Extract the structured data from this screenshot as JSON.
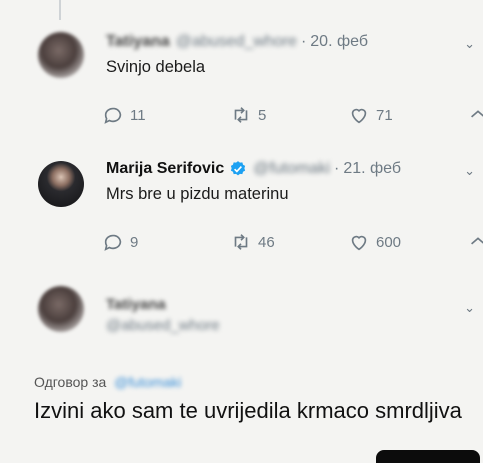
{
  "tweets": [
    {
      "name": "Tatiyana",
      "handle": "@abused_whore",
      "date": "20. феб",
      "text": "Svinjo debela",
      "replies": "11",
      "retweets": "5",
      "likes": "71"
    },
    {
      "name": "Marija Serifovic",
      "handle": "@futomaki",
      "date": "21. феб",
      "text": "Mrs bre u pizdu materinu",
      "replies": "9",
      "retweets": "46",
      "likes": "600"
    }
  ],
  "reply_tweet": {
    "name": "Tatiyana",
    "handle": "@abused_whore",
    "reply_prefix": "Одговор за",
    "reply_handle": "@futomaki",
    "text": "Izvini ako sam te uvrijedila krmaco smrdljiva"
  },
  "colors": {
    "background": "#f4f4f2",
    "verified": "#1da1f2",
    "muted": "#6e7a84",
    "link": "#3a8fd8"
  },
  "icons": [
    "reply-icon",
    "retweet-icon",
    "like-icon",
    "share-icon",
    "chevron-down-icon",
    "verified-badge-icon"
  ]
}
